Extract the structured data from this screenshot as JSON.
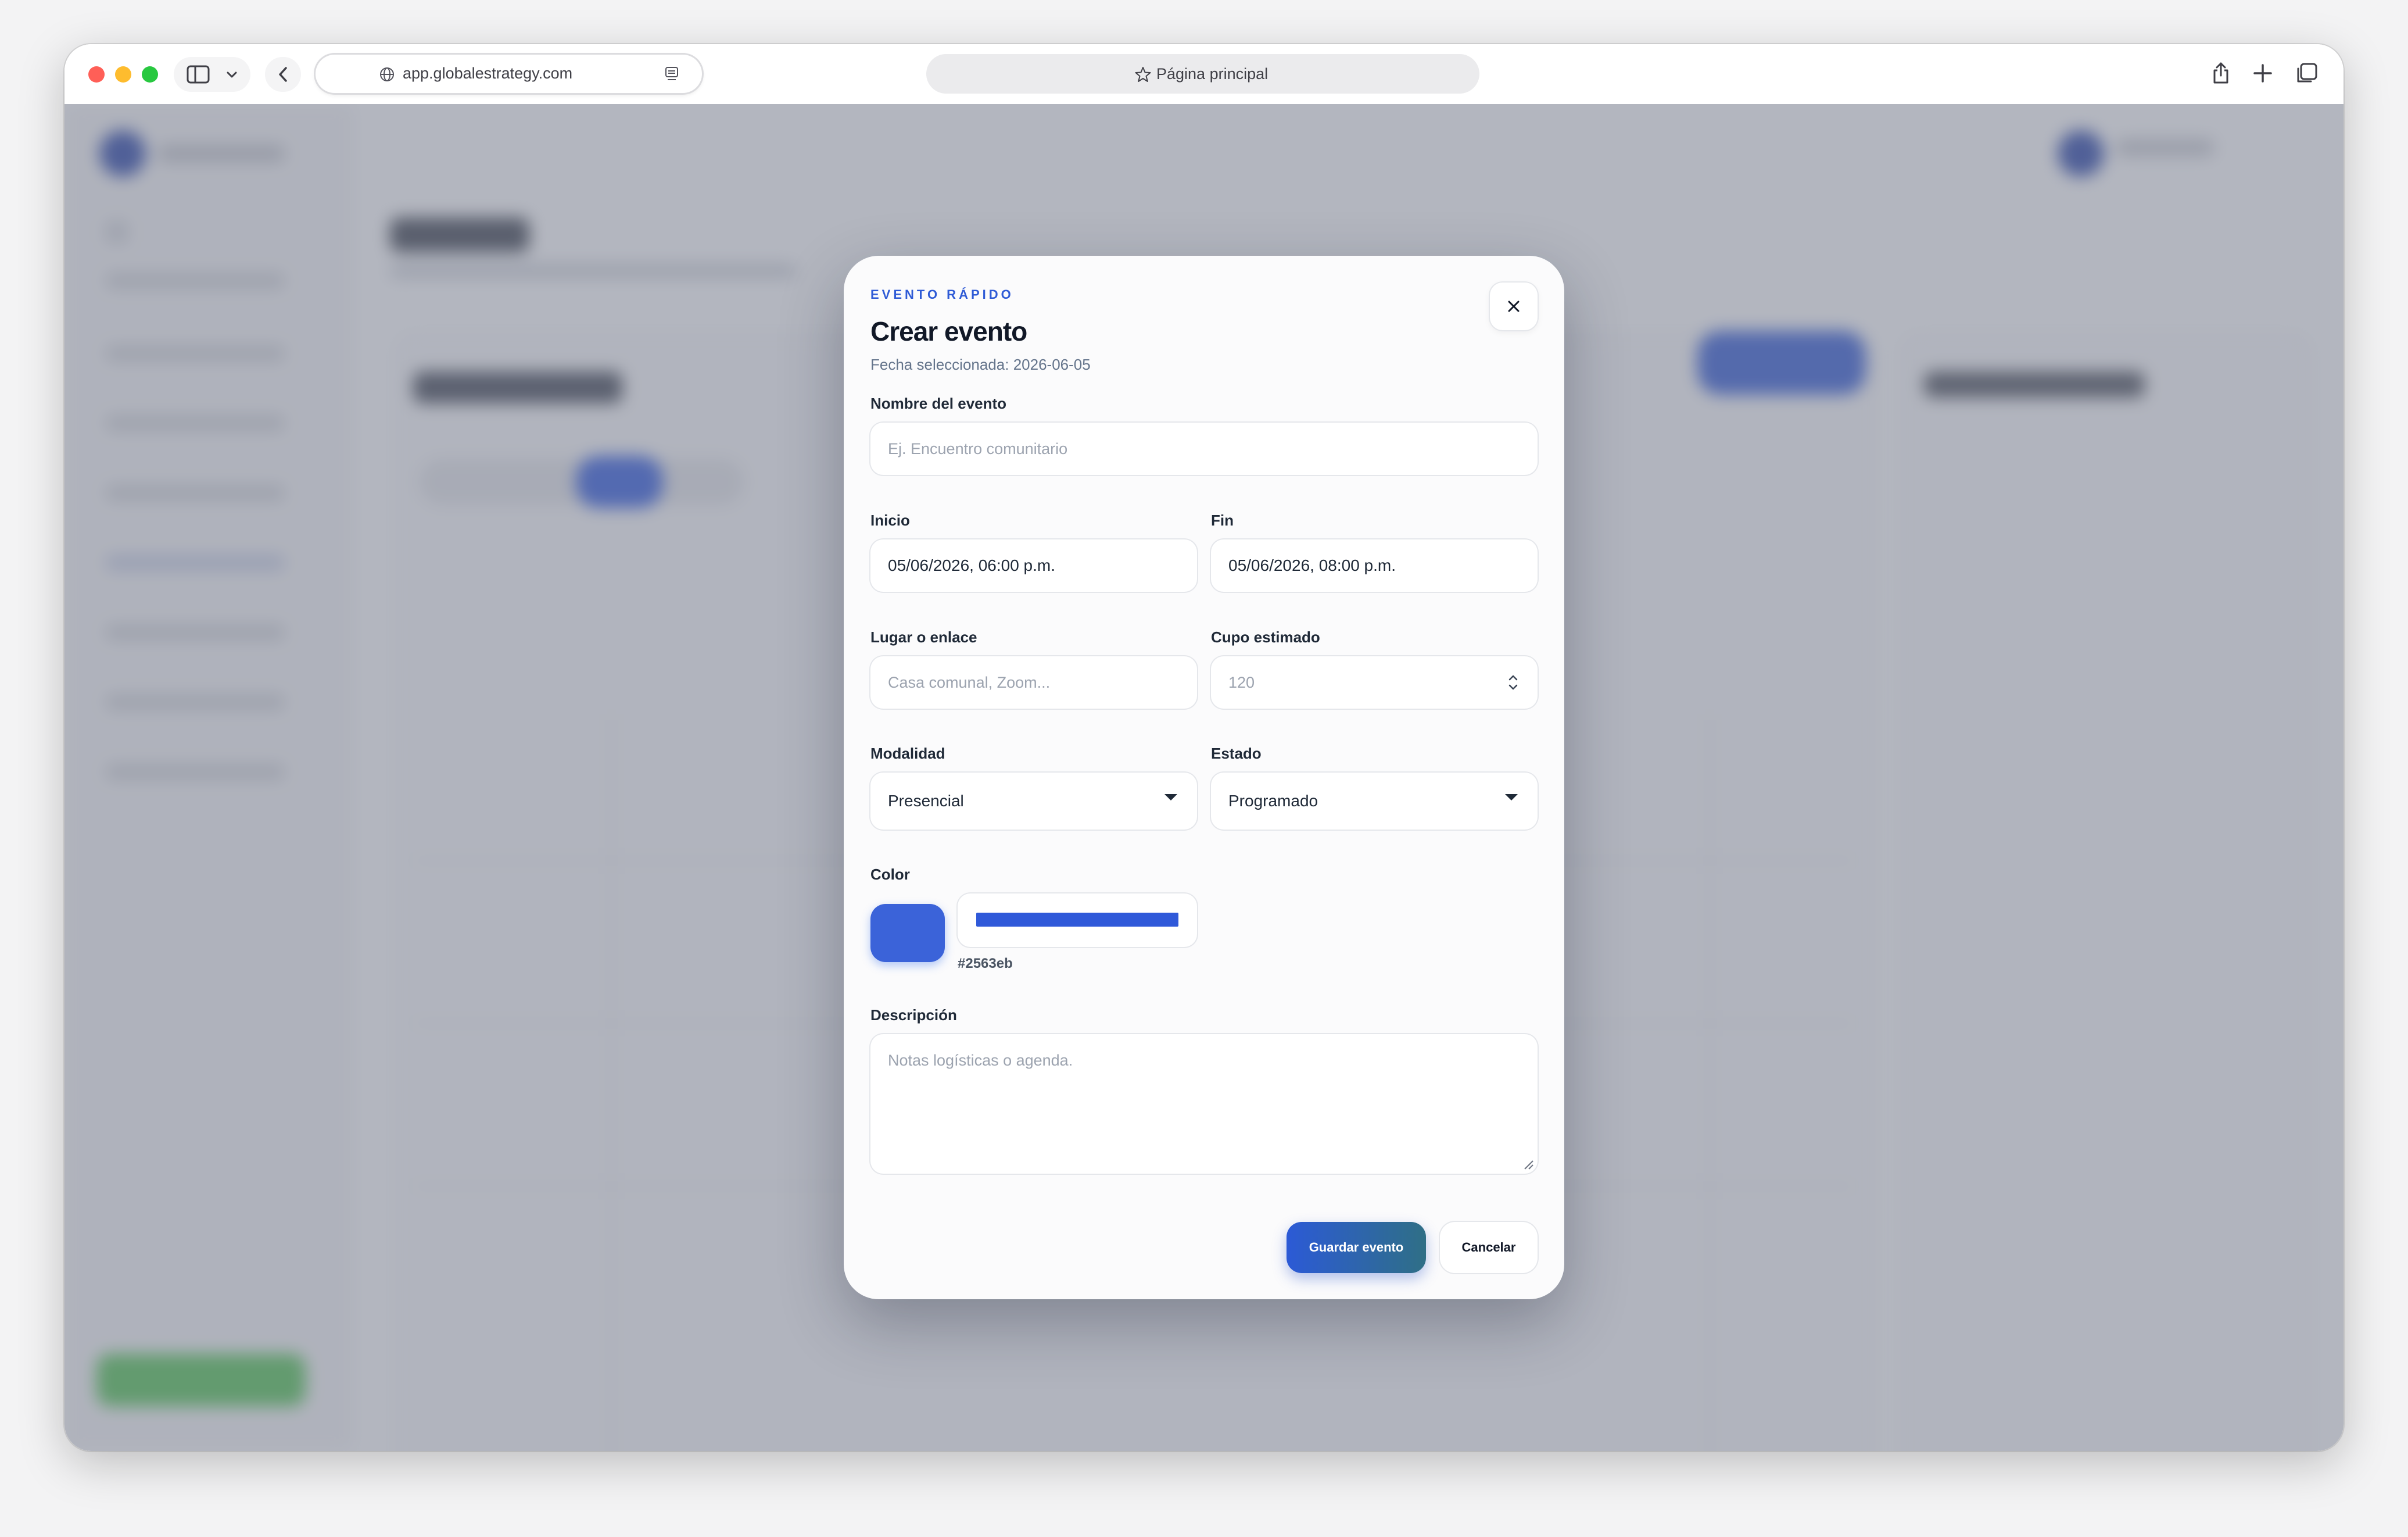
{
  "browser": {
    "url": "app.globalestrategy.com",
    "tab_title": "Página principal"
  },
  "modal": {
    "eyebrow": "EVENTO RÁPIDO",
    "title": "Crear evento",
    "subtitle": "Fecha seleccionada: 2026-06-05",
    "fields": {
      "name": {
        "label": "Nombre del evento",
        "value": "",
        "placeholder": "Ej. Encuentro comunitario"
      },
      "start": {
        "label": "Inicio",
        "value": "05/06/2026, 06:00 p.m."
      },
      "end": {
        "label": "Fin",
        "value": "05/06/2026, 08:00 p.m."
      },
      "location": {
        "label": "Lugar o enlace",
        "value": "",
        "placeholder": "Casa comunal, Zoom..."
      },
      "capacity": {
        "label": "Cupo estimado",
        "value": "",
        "placeholder": "120"
      },
      "mode": {
        "label": "Modalidad",
        "selected": "Presencial"
      },
      "status": {
        "label": "Estado",
        "selected": "Programado"
      },
      "color": {
        "label": "Color",
        "hex": "#2563eb",
        "swatch": "#3b63d9"
      },
      "description": {
        "label": "Descripción",
        "value": "",
        "placeholder": "Notas logísticas o agenda."
      }
    },
    "actions": {
      "save": "Guardar evento",
      "cancel": "Cancelar"
    }
  },
  "icons": {
    "close": "close-icon",
    "dropdown": "caret-down-icon",
    "stepper": "stepper-icon",
    "back": "chevron-left-icon",
    "share": "share-icon",
    "new_tab": "plus-icon",
    "tabs_overview": "tabs-icon"
  },
  "colors": {
    "accent": "#2f5bd6",
    "primary_gradient_start": "#2c5ad6",
    "primary_gradient_end": "#2f6f86"
  }
}
